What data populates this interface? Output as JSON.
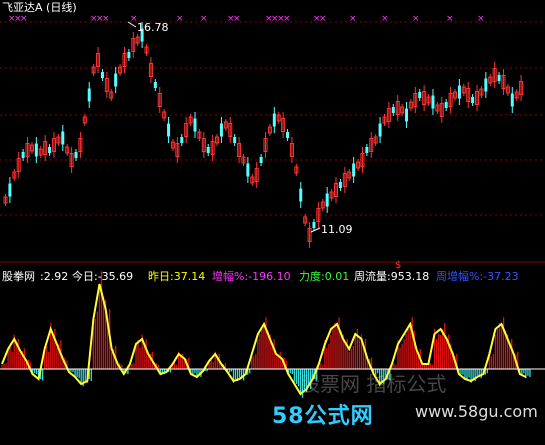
{
  "window": {
    "title": "飞亚达A (日线)"
  },
  "upper_chart": {
    "high_label": "16.78",
    "low_label": "11.09",
    "signal_marker": "$",
    "marker_glyph": "×",
    "colors": {
      "up": "#ff3333",
      "down": "#54ffff",
      "marker": "#ff33ff",
      "grid": "#8b0000",
      "text": "#ffffff"
    }
  },
  "indicator": {
    "name": "股拳网",
    "value": ":2.92",
    "today_label": "今日:-35.69",
    "yesterday_label": "昨日:37.14",
    "gain_label": "增幅%:-196.10",
    "force_label": "力度:0.01",
    "flow_label": "周流量:953.18",
    "week_gain_label": "周增幅%:-37.23",
    "colors": {
      "name": "#ffffff",
      "today": "#ffffff",
      "yesterday": "#ffff00",
      "gain": "#ff33ff",
      "force": "#33ff33",
      "flow": "#ffffff",
      "week_gain": "#3355ff",
      "bar_up": "#dd1111",
      "bar_down": "#33dddd",
      "line": "#ffff33"
    }
  },
  "branding": {
    "logo_text": "58公式网",
    "url": "www.58gu.com",
    "watermark": "股票网 指标公式",
    "colors": {
      "digits": "#33ccff",
      "chars": "#ff3333"
    }
  }
}
